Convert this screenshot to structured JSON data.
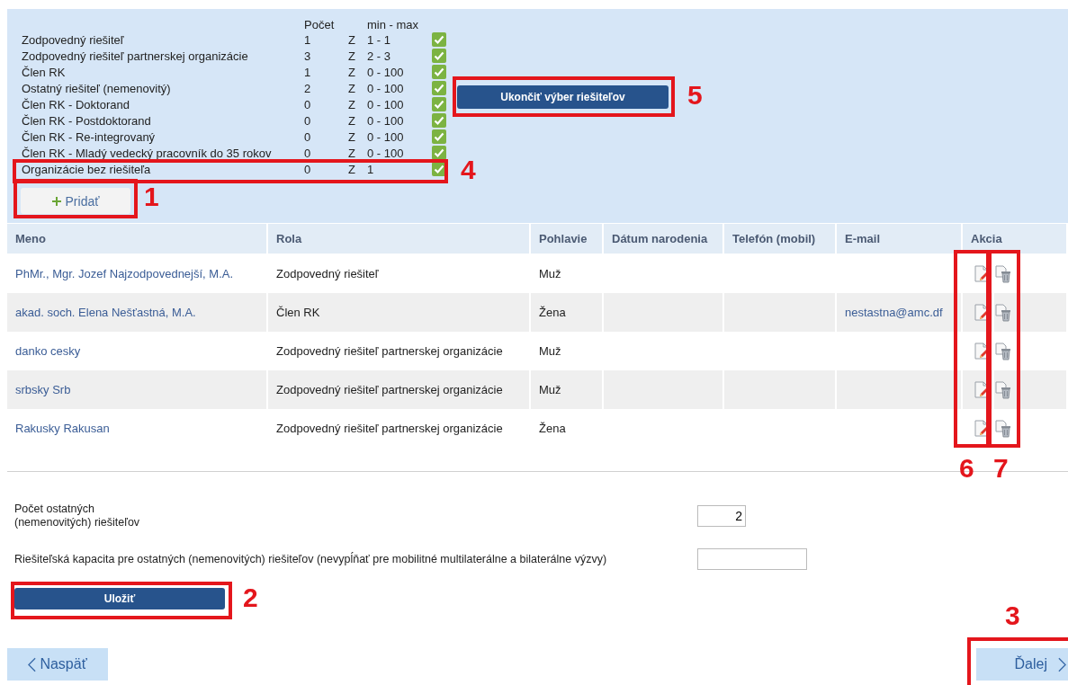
{
  "limits": {
    "columns": [
      "Počet",
      "min - max"
    ],
    "rows": [
      {
        "role": "Zodpovedný riešiteľ",
        "count": "1",
        "z": "Z",
        "range": "1 - 1",
        "ok": true
      },
      {
        "role": "Zodpovedný riešiteľ partnerskej organizácie",
        "count": "3",
        "z": "Z",
        "range": "2 - 3",
        "ok": true
      },
      {
        "role": "Člen RK",
        "count": "1",
        "z": "Z",
        "range": "0 - 100",
        "ok": true
      },
      {
        "role": "Ostatný riešiteľ (nemenovitý)",
        "count": "2",
        "z": "Z",
        "range": "0 - 100",
        "ok": true
      },
      {
        "role": "Člen RK - Doktorand",
        "count": "0",
        "z": "Z",
        "range": "0 - 100",
        "ok": true
      },
      {
        "role": "Člen RK - Postdoktorand",
        "count": "0",
        "z": "Z",
        "range": "0 - 100",
        "ok": true
      },
      {
        "role": "Člen RK - Re-integrovaný",
        "count": "0",
        "z": "Z",
        "range": "0 - 100",
        "ok": true
      },
      {
        "role": "Člen RK - Mladý vedecký pracovník do 35 rokov",
        "count": "0",
        "z": "Z",
        "range": "0 - 100",
        "ok": true
      },
      {
        "role": "Organizácie bez riešiteľa",
        "count": "0",
        "z": "Z",
        "range": "1",
        "ok": true
      }
    ]
  },
  "add_button": {
    "label": "Pridať"
  },
  "finish_button": {
    "label": "Ukončiť výber riešiteľov"
  },
  "table": {
    "columns": [
      "Meno",
      "Rola",
      "Pohlavie",
      "Dátum narodenia",
      "Telefón (mobil)",
      "E-mail",
      "Akcia"
    ],
    "rows": [
      {
        "name": "PhMr., Mgr. Jozef Najzodpovednejší, M.A.",
        "role": "Zodpovedný riešiteľ",
        "gender": "Muž"
      },
      {
        "name": "akad. soch. Elena Nešťastná, M.A.",
        "role": "Člen RK",
        "gender": "Žena",
        "email": "nestastna@amc.df"
      },
      {
        "name": "danko cesky",
        "role": "Zodpovedný riešiteľ partnerskej organizácie",
        "gender": "Muž"
      },
      {
        "name": "srbsky Srb",
        "role": "Zodpovedný riešiteľ partnerskej organizácie",
        "gender": "Muž"
      },
      {
        "name": "Rakusky Rakusan",
        "role": "Zodpovedný riešiteľ partnerskej organizácie",
        "gender": "Žena"
      }
    ]
  },
  "form": {
    "fields": [
      {
        "label": "Počet ostatných\n(nemenovitých) riešiteľov",
        "value": "2",
        "kind": "short"
      },
      {
        "label": "Riešiteľská kapacita pre ostatných (nemenovitých) riešiteľov (nevypĺňať pre mobilitné multilaterálne a bilaterálne výzvy)",
        "kind": "wide"
      }
    ]
  },
  "save_button": {
    "label": "Uložiť"
  },
  "back_button": {
    "label": "Naspäť"
  },
  "next_button": {
    "label": "Ďalej"
  },
  "annotations": [
    {
      "number": "1"
    },
    {
      "number": "2"
    },
    {
      "number": "3"
    },
    {
      "number": "4"
    },
    {
      "number": "5"
    },
    {
      "number": "6"
    },
    {
      "number": "7"
    }
  ]
}
